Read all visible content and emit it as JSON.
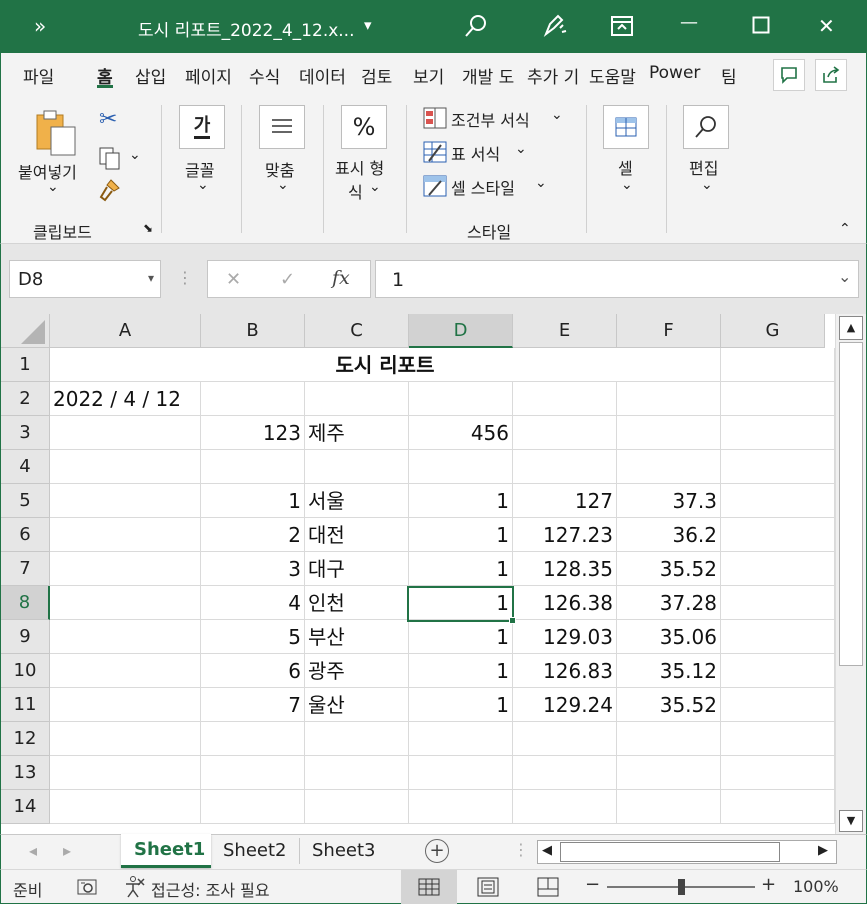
{
  "titlebar": {
    "qat_glyph": "»",
    "title": "도시 리포트_2022_4_12.x...",
    "title_dropdown": "▾",
    "minimize": "—",
    "close": "✕"
  },
  "tabs": [
    "파일",
    "홈",
    "삽입",
    "페이지",
    "수식",
    "데이터",
    "검토",
    "보기",
    "개발 도",
    "추가 기",
    "도움말",
    "Power",
    "팀"
  ],
  "ribbon": {
    "paste_label_1": "붙여넣기",
    "paste_arrow": "⌄",
    "cut_glyph": "✂",
    "copy_arrow": "⌄",
    "clipboard_group": "클립보드",
    "dialog_launcher": "⬊",
    "font_icon_text": "가",
    "font_label": "글꼴",
    "align_label": "맞춤",
    "number_icon": "%",
    "number_label_1": "표시 형",
    "number_label_2": "식",
    "cond_format": "조건부 서식",
    "table_format": "표 서식",
    "cell_style": "셀 스타일",
    "styles_group": "스타일",
    "cells_label": "셀",
    "edit_label": "편집",
    "chevron": "⌄",
    "collapse": "⌃"
  },
  "formula_bar": {
    "name_box": "D8",
    "name_arrow": "▾",
    "dots": "⋮",
    "cancel": "✕",
    "enter": "✓",
    "fx": "fx",
    "value": "1",
    "expand": "⌄"
  },
  "grid": {
    "columns": [
      "A",
      "B",
      "C",
      "D",
      "E",
      "F",
      "G"
    ],
    "selected_col": "D",
    "selected_row": "8",
    "rows": [
      {
        "n": "1",
        "title": "도시 리포트"
      },
      {
        "n": "2",
        "A": "2022 / 4 / 12",
        "B": "",
        "C": "",
        "D": "",
        "E": "",
        "F": ""
      },
      {
        "n": "3",
        "A": "",
        "B": "123",
        "C": "제주",
        "D": "456",
        "E": "",
        "F": ""
      },
      {
        "n": "4",
        "A": "",
        "B": "",
        "C": "",
        "D": "",
        "E": "",
        "F": ""
      },
      {
        "n": "5",
        "A": "",
        "B": "1",
        "C": "서울",
        "D": "1",
        "E": "127",
        "F": "37.3"
      },
      {
        "n": "6",
        "A": "",
        "B": "2",
        "C": "대전",
        "D": "1",
        "E": "127.23",
        "F": "36.2"
      },
      {
        "n": "7",
        "A": "",
        "B": "3",
        "C": "대구",
        "D": "1",
        "E": "128.35",
        "F": "35.52"
      },
      {
        "n": "8",
        "A": "",
        "B": "4",
        "C": "인천",
        "D": "1",
        "E": "126.38",
        "F": "37.28"
      },
      {
        "n": "9",
        "A": "",
        "B": "5",
        "C": "부산",
        "D": "1",
        "E": "129.03",
        "F": "35.06"
      },
      {
        "n": "10",
        "A": "",
        "B": "6",
        "C": "광주",
        "D": "1",
        "E": "126.83",
        "F": "35.12"
      },
      {
        "n": "11",
        "A": "",
        "B": "7",
        "C": "울산",
        "D": "1",
        "E": "129.24",
        "F": "35.52"
      },
      {
        "n": "12",
        "A": "",
        "B": "",
        "C": "",
        "D": "",
        "E": "",
        "F": ""
      },
      {
        "n": "13",
        "A": "",
        "B": "",
        "C": "",
        "D": "",
        "E": "",
        "F": ""
      },
      {
        "n": "14",
        "A": "",
        "B": "",
        "C": "",
        "D": "",
        "E": "",
        "F": ""
      }
    ]
  },
  "scroll": {
    "up": "▲",
    "down": "▼",
    "left": "◀",
    "right": "▶",
    "nav_prev": "◂",
    "nav_next": "▸",
    "more": "⋮"
  },
  "sheets": {
    "active": "Sheet1",
    "others": [
      "Sheet2",
      "Sheet3"
    ],
    "add": "+"
  },
  "status": {
    "ready": "준비",
    "accessibility": "접근성: 조사 필요",
    "zoom_minus": "−",
    "zoom_plus": "+",
    "zoom": "100%",
    "zoom_level": 0.5
  },
  "colors": {
    "accent": "#217346",
    "ribbon_bg": "#f3f3f3",
    "header_bg": "#e6e6e6",
    "selection": "#217346"
  }
}
